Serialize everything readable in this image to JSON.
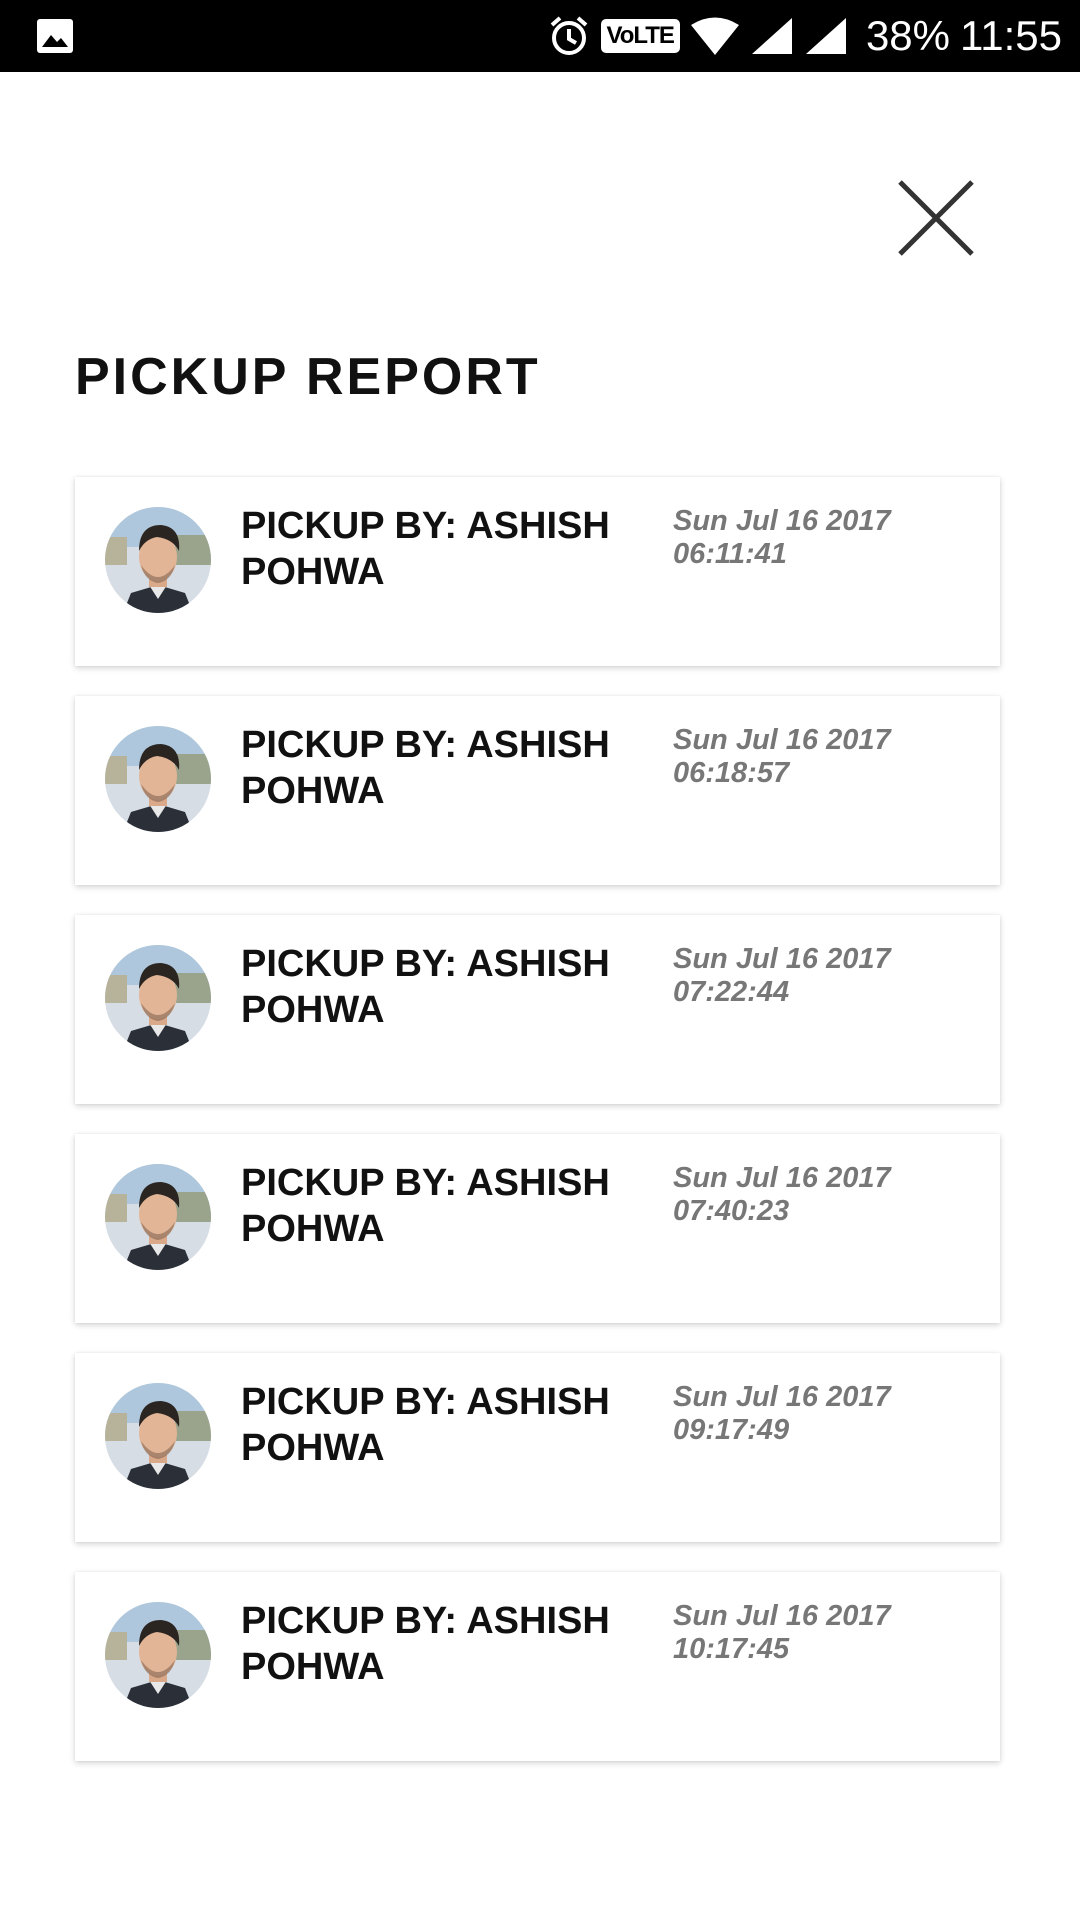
{
  "status_bar": {
    "battery_text": "38%",
    "time": "11:55",
    "volte_label": "VoLTE",
    "icons": [
      "gallery-icon",
      "alarm-icon",
      "volte-icon",
      "wifi-icon",
      "signal-icon",
      "signal-icon"
    ]
  },
  "header": {
    "close_icon": "close-icon",
    "title": "PICKUP REPORT"
  },
  "pickups": [
    {
      "name": "PICKUP BY: ASHISH POHWA",
      "date": "Sun Jul 16 2017 06:11:41"
    },
    {
      "name": "PICKUP BY: ASHISH POHWA",
      "date": "Sun Jul 16 2017 06:18:57"
    },
    {
      "name": "PICKUP BY: ASHISH POHWA",
      "date": "Sun Jul 16 2017 07:22:44"
    },
    {
      "name": "PICKUP BY: ASHISH POHWA",
      "date": "Sun Jul 16 2017 07:40:23"
    },
    {
      "name": "PICKUP BY: ASHISH POHWA",
      "date": "Sun Jul 16 2017 09:17:49"
    },
    {
      "name": "PICKUP BY: ASHISH POHWA",
      "date": "Sun Jul 16 2017 10:17:45"
    }
  ],
  "colors": {
    "title": "#111111",
    "date": "#777777",
    "status_bar_bg": "#000000",
    "background": "#ffffff"
  }
}
